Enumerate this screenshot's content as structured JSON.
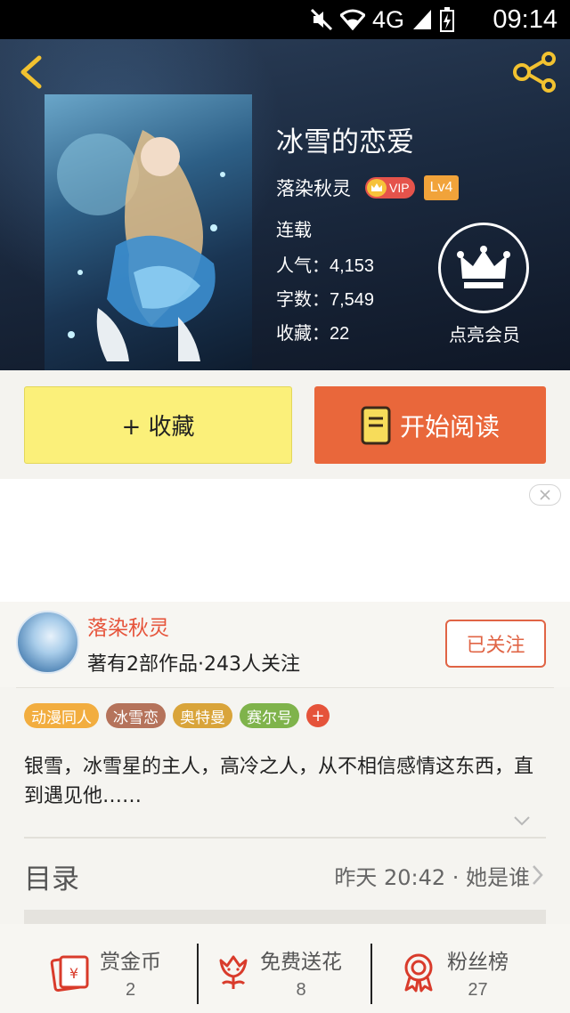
{
  "status_bar": {
    "network": "4G",
    "time": "09:14"
  },
  "book": {
    "title": "冰雪的恋爱",
    "author": "落染秋灵",
    "vip_badge": "VIP",
    "level": "Lv4",
    "status": "连载",
    "popularity_label": "人气：",
    "popularity": "4,153",
    "words_label": "字数：",
    "words": "7,549",
    "favorites_label": "收藏：",
    "favorites": "22",
    "member_label": "点亮会员"
  },
  "actions": {
    "favorite": "+ 收藏",
    "read": "开始阅读"
  },
  "author_card": {
    "name": "落染秋灵",
    "meta": "著有2部作品·243人关注",
    "follow": "已关注"
  },
  "tags": [
    {
      "label": "动漫同人",
      "color": "#f2ad3f"
    },
    {
      "label": "冰雪恋",
      "color": "#b5735b"
    },
    {
      "label": "奥特曼",
      "color": "#d9a43a"
    },
    {
      "label": "赛尔号",
      "color": "#7fb34b"
    }
  ],
  "description": "银雪，冰雪星的主人，高冷之人，从不相信感情这东西，直到遇见他……",
  "toc": {
    "label": "目录",
    "latest": "昨天 20:42 · 她是谁"
  },
  "bottom": {
    "reward": {
      "label": "赏金币",
      "count": "2"
    },
    "flower": {
      "label": "免费送花",
      "count": "8"
    },
    "fans": {
      "label": "粉丝榜",
      "count": "27"
    }
  },
  "colors": {
    "accent": "#e9673b",
    "favorite_button": "#fbf07a",
    "author_name": "#e6533a"
  }
}
